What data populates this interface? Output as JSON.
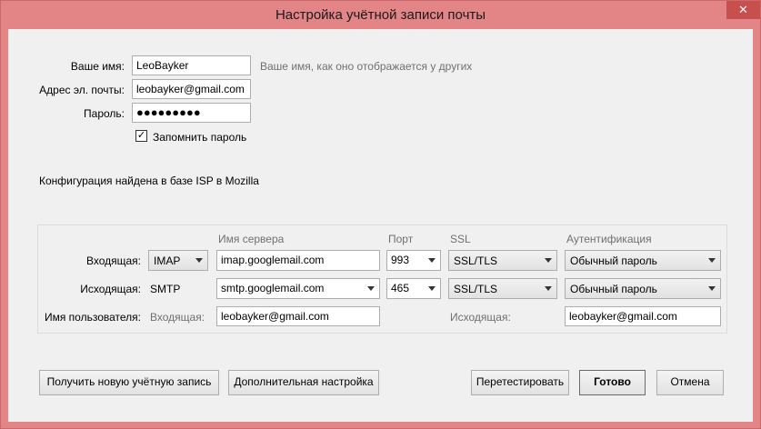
{
  "window": {
    "title": "Настройка учётной записи почты",
    "close_label": "✕"
  },
  "identity": {
    "name_label": "Ваше имя:",
    "name_value": "LeoBayker",
    "name_hint": "Ваше имя, как оно отображается у других",
    "email_label": "Адрес эл. почты:",
    "email_value": "leobayker@gmail.com",
    "password_label": "Пароль:",
    "password_value": "●●●●●●●●●",
    "remember_label": "Запомнить пароль",
    "remember_checked": true
  },
  "status": "Конфигурация найдена в базе ISP в Mozilla",
  "servers": {
    "headers": {
      "server": "Имя сервера",
      "port": "Порт",
      "ssl": "SSL",
      "auth": "Аутентификация"
    },
    "incoming": {
      "label": "Входящая:",
      "protocol": "IMAP",
      "server": "imap.googlemail.com",
      "port": "993",
      "ssl": "SSL/TLS",
      "auth": "Обычный пароль"
    },
    "outgoing": {
      "label": "Исходящая:",
      "protocol": "SMTP",
      "server": "smtp.googlemail.com",
      "port": "465",
      "ssl": "SSL/TLS",
      "auth": "Обычный пароль"
    },
    "username": {
      "label": "Имя пользователя:",
      "incoming_label": "Входящая:",
      "incoming_value": "leobayker@gmail.com",
      "outgoing_label": "Исходящая:",
      "outgoing_value": "leobayker@gmail.com"
    }
  },
  "buttons": {
    "new_account": "Получить новую учётную запись",
    "advanced": "Дополнительная настройка",
    "retest": "Перетестировать",
    "done": "Готово",
    "cancel": "Отмена"
  }
}
